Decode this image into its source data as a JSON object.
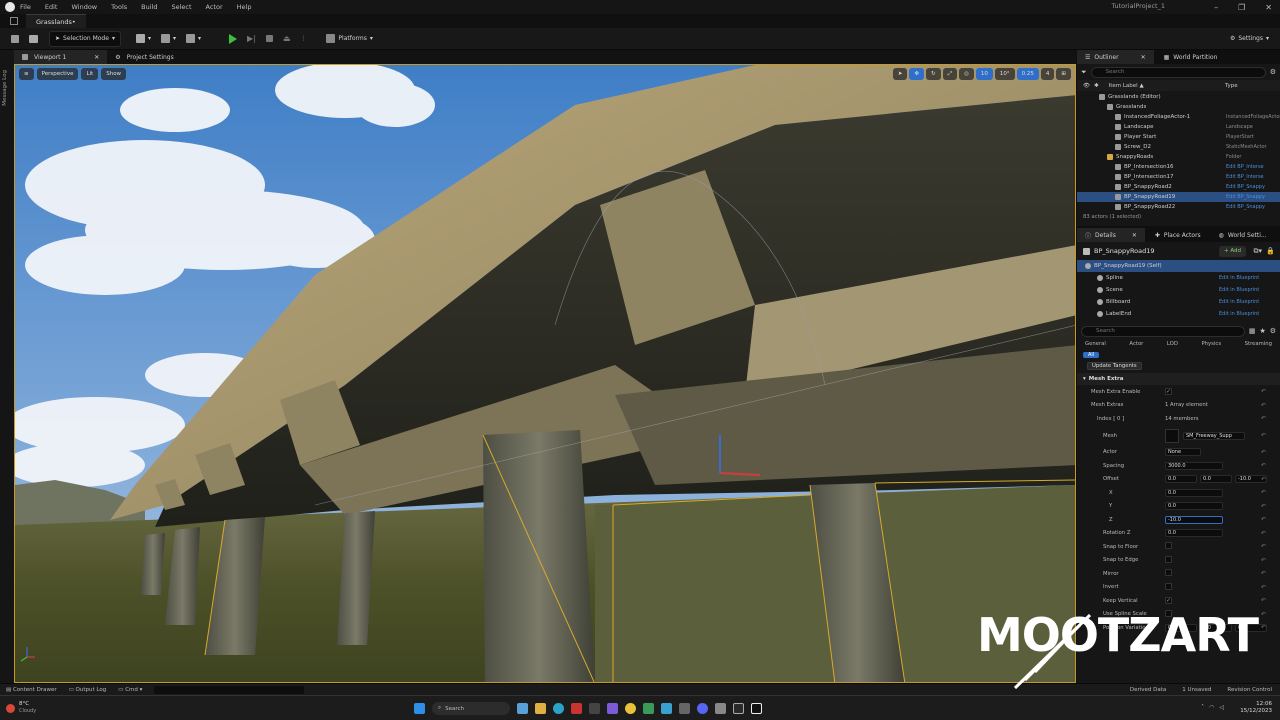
{
  "menu": [
    "File",
    "Edit",
    "Window",
    "Tools",
    "Build",
    "Select",
    "Actor",
    "Help"
  ],
  "project_title": "TutorialProject_1",
  "window_controls": [
    "–",
    "❐",
    "✕"
  ],
  "doc_tab": "Grasslands•",
  "toolbar": {
    "selection_mode": "Selection Mode",
    "platforms": "Platforms",
    "settings": "Settings"
  },
  "left_strip_label": "Message Log",
  "viewport_tabs": [
    "Viewport 1",
    "Project Settings"
  ],
  "viewport_overlay": {
    "perspective": "Perspective",
    "lit": "Lit",
    "show": "Show",
    "snap_values": [
      "10",
      "10°",
      "0.25"
    ],
    "camera_speed": "4"
  },
  "outliner": {
    "tabs": [
      "Outliner",
      "World Partition"
    ],
    "search_placeholder": "Search",
    "col_label": "Item Label ▲",
    "col_type": "Type",
    "rows": [
      {
        "label": "Grasslands (Editor)",
        "type": "",
        "indent": 1,
        "link": false,
        "selected": false
      },
      {
        "label": "Grasslands",
        "type": "",
        "indent": 2,
        "link": false,
        "selected": false
      },
      {
        "label": "InstancedFoliageActor-1",
        "type": "InstancedFoliageActor",
        "indent": 3,
        "link": false,
        "selected": false
      },
      {
        "label": "Landscape",
        "type": "Landscape",
        "indent": 3,
        "link": false,
        "selected": false
      },
      {
        "label": "Player Start",
        "type": "PlayerStart",
        "indent": 3,
        "link": false,
        "selected": false
      },
      {
        "label": "Screw_D2",
        "type": "StaticMeshActor",
        "indent": 3,
        "link": false,
        "selected": false
      },
      {
        "label": "SnappyRoads",
        "type": "Folder",
        "indent": 2,
        "link": false,
        "selected": false
      },
      {
        "label": "BP_Intersection16",
        "type": "Edit BP_Interse",
        "indent": 3,
        "link": true,
        "selected": false
      },
      {
        "label": "BP_Intersection17",
        "type": "Edit BP_Interse",
        "indent": 3,
        "link": true,
        "selected": false
      },
      {
        "label": "BP_SnappyRoad2",
        "type": "Edit BP_Snappy",
        "indent": 3,
        "link": true,
        "selected": false
      },
      {
        "label": "BP_SnappyRoad19",
        "type": "Edit BP_Snappy",
        "indent": 3,
        "link": true,
        "selected": true
      },
      {
        "label": "BP_SnappyRoad22",
        "type": "Edit BP_Snappy",
        "indent": 3,
        "link": true,
        "selected": false
      }
    ],
    "footer": "83 actors (1 selected)"
  },
  "details": {
    "tabs": [
      "Details",
      "Place Actors",
      "World Setti..."
    ],
    "actor_name": "BP_SnappyRoad19",
    "add_label": "+ Add",
    "components": [
      {
        "label": "BP_SnappyRoad19 (Self)",
        "link": "",
        "selected": true
      },
      {
        "label": "Spline",
        "link": "Edit in Blueprint",
        "selected": false
      },
      {
        "label": "Scene",
        "link": "Edit in Blueprint",
        "selected": false
      },
      {
        "label": "Billboard",
        "link": "Edit in Blueprint",
        "selected": false
      },
      {
        "label": "LabelEnd",
        "link": "Edit in Blueprint",
        "selected": false
      }
    ],
    "search_placeholder": "Search",
    "category_tabs": [
      "General",
      "Actor",
      "LOD",
      "Physics",
      "Streaming"
    ],
    "all_tab": "All",
    "update_tangents": "Update Tangents",
    "section": "Mesh Extra",
    "props": [
      {
        "label": "Mesh Extra Enable",
        "kind": "check",
        "value": "✓",
        "indent": 0
      },
      {
        "label": "Mesh Extras",
        "kind": "text",
        "value": "1 Array element",
        "indent": 0
      },
      {
        "label": "Index [ 0 ]",
        "kind": "text",
        "value": "14 members",
        "indent": 1
      },
      {
        "label": "Mesh",
        "kind": "asset",
        "value": "SM_Freeway_Supp",
        "indent": 2
      },
      {
        "label": "Actor",
        "kind": "select",
        "value": "None",
        "indent": 2
      },
      {
        "label": "Spacing",
        "kind": "num",
        "value": "3000.0",
        "indent": 2
      },
      {
        "label": "Offset",
        "kind": "triple",
        "value": "0.0|0.0|-10.0",
        "indent": 2
      },
      {
        "label": "X",
        "kind": "num",
        "value": "0.0",
        "indent": 3
      },
      {
        "label": "Y",
        "kind": "num",
        "value": "0.0",
        "indent": 3
      },
      {
        "label": "Z",
        "kind": "num",
        "value": "-10.0",
        "indent": 3
      },
      {
        "label": "Rotation Z",
        "kind": "num",
        "value": "0.0",
        "indent": 2
      },
      {
        "label": "Snap to Floor",
        "kind": "check",
        "value": "",
        "indent": 2
      },
      {
        "label": "Snap to Edge",
        "kind": "check",
        "value": "",
        "indent": 2
      },
      {
        "label": "Mirror",
        "kind": "check",
        "value": "",
        "indent": 2
      },
      {
        "label": "Invert",
        "kind": "check",
        "value": "",
        "indent": 2
      },
      {
        "label": "Keep Vertical",
        "kind": "check",
        "value": "✓",
        "indent": 2
      },
      {
        "label": "Use Spline Scale",
        "kind": "check",
        "value": "",
        "indent": 2
      },
      {
        "label": "Position Variation",
        "kind": "triple",
        "value": "0.0|0.0|0.0",
        "indent": 2
      }
    ]
  },
  "statusbar": {
    "content_drawer": "Content Drawer",
    "output_log": "Output Log",
    "cmd": "Cmd",
    "derived_data": "Derived Data",
    "unsaved": "1 Unsaved",
    "revision": "Revision Control"
  },
  "taskbar": {
    "weather_temp": "8°C",
    "weather_text": "Cloudy",
    "search": "Search",
    "time": "12:06",
    "date": "15/12/2023"
  },
  "watermark": "MOOTZART",
  "colors": {
    "accent_blue": "#2b4f83",
    "link_blue": "#4a8fe0",
    "play_green": "#3fbf3f",
    "selection_outline": "#c79a25"
  }
}
